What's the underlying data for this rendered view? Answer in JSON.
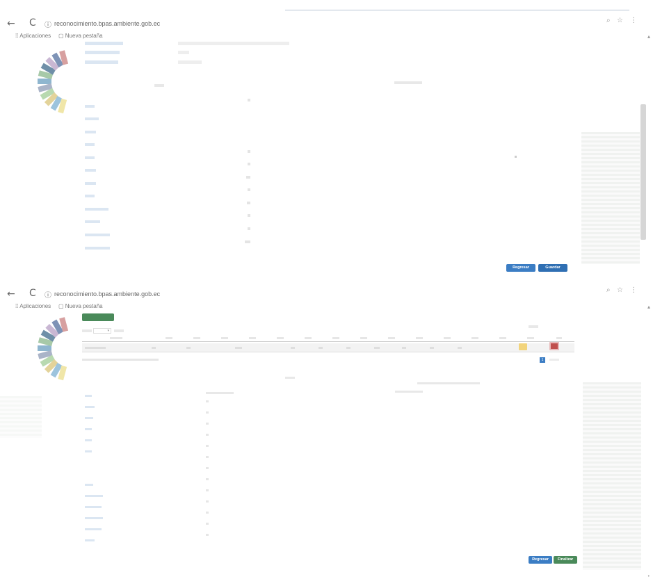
{
  "browser": {
    "back_icon": "arrow-left",
    "reload_icon": "reload",
    "info_icon": "info",
    "url_main": "reconocimiento.bpas.ambiente.gob.ec",
    "url_path": "",
    "bookmarks": [
      {
        "icon": "apps-grid",
        "label": "Aplicaciones"
      },
      {
        "icon": "page",
        "label": "Nueva pestaña"
      }
    ],
    "right_icons": [
      "search-icon",
      "star-icon",
      "menu-icon"
    ]
  },
  "top": {
    "header_rows": [
      {
        "label": "",
        "value": ""
      },
      {
        "label": "",
        "value": ""
      },
      {
        "label": "",
        "value": ""
      }
    ],
    "rows": [
      {
        "label": "",
        "value": ""
      },
      {
        "label": "",
        "value": ""
      },
      {
        "label": "",
        "value": ""
      },
      {
        "label": "",
        "value": ""
      },
      {
        "label": "",
        "value": ""
      },
      {
        "label": "",
        "value": ""
      },
      {
        "label": "",
        "value": ""
      },
      {
        "label": "",
        "value": ""
      },
      {
        "label": "",
        "value": ""
      },
      {
        "label": "",
        "value": ""
      },
      {
        "label": "",
        "value": ""
      },
      {
        "label": "",
        "value": ""
      }
    ],
    "buttons": {
      "back": "Regresar",
      "next": "Guardar"
    }
  },
  "bottom": {
    "new_button": "",
    "table_rows_count": 1,
    "page_current": "1",
    "buttons": {
      "back": "Regresar",
      "next": "Finalizar"
    },
    "rows": [
      {
        "label": ""
      },
      {
        "label": ""
      },
      {
        "label": ""
      },
      {
        "label": ""
      },
      {
        "label": ""
      },
      {
        "label": ""
      },
      {
        "label": ""
      },
      {
        "label": ""
      },
      {
        "label": ""
      },
      {
        "label": ""
      },
      {
        "label": ""
      },
      {
        "label": ""
      }
    ]
  },
  "colors": {
    "accent_blue": "#3b7dc4",
    "accent_green": "#4a8a5a",
    "link_blue": "#7a9cc0"
  }
}
